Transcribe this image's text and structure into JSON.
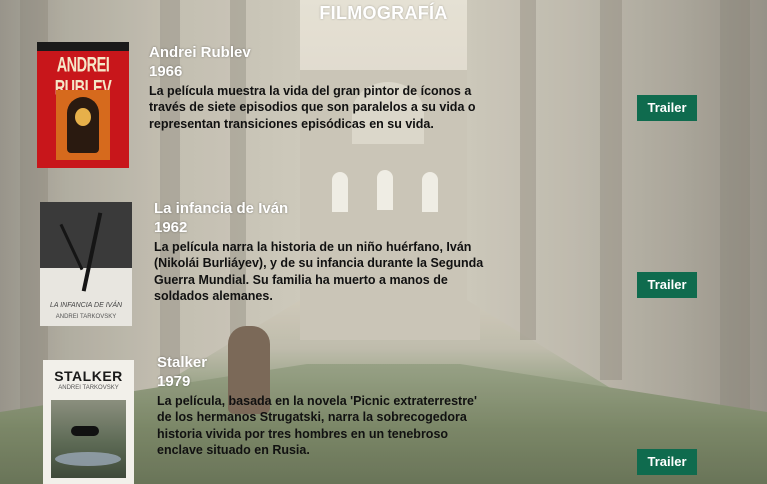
{
  "header": {
    "title": "FILMOGRAFÍA"
  },
  "films": [
    {
      "title": "Andrei Rublev",
      "year": "1966",
      "description": "La película muestra la vida del gran pintor de íconos a través de siete episodios que son paralelos a su vida o representan transiciones episódicas en su vida.",
      "poster_text": "ANDREI RUBLEV",
      "trailer_label": "Trailer"
    },
    {
      "title": "La infancia de Iván",
      "year": "1962",
      "description": "La película narra la historia de un niño huérfano, Iván (Nikolái Burliáyev), y de su infancia durante la Segunda Guerra Mundial. Su familia ha muerto a manos de soldados alemanes.",
      "poster_text": "LA INFANCIA DE IVÁN",
      "poster_subtext": "ANDREI TARKOVSKY",
      "trailer_label": "Trailer"
    },
    {
      "title": "Stalker",
      "year": "1979",
      "description": "La película, basada en la novela 'Picnic extraterrestre' de los hermanos Strugatski, narra la sobrecogedora historia vivida por tres hombres en un tenebroso enclave situado en Rusia.",
      "poster_text": "STALKER",
      "poster_subtext": "ANDREI TARKOVSKY",
      "trailer_label": "Trailer"
    }
  ],
  "colors": {
    "trailer_button": "#0f6b4e",
    "title_text": "#ffffff",
    "body_text": "#111111"
  }
}
